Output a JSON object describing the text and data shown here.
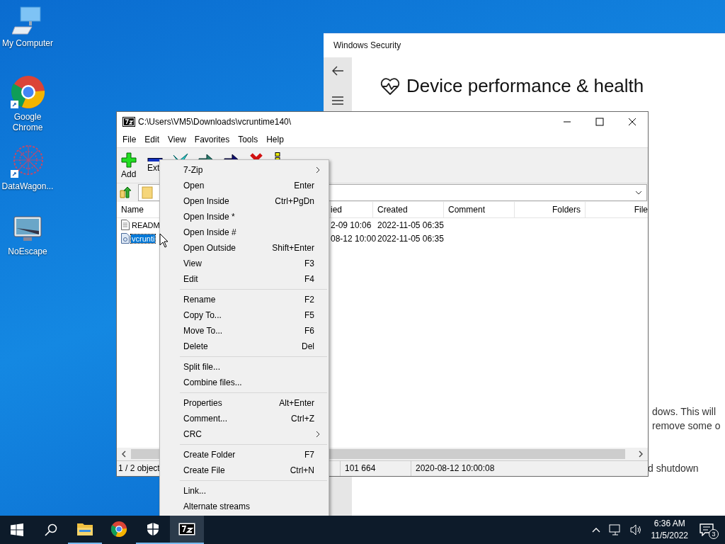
{
  "desktop_icons": [
    {
      "label": "My Computer",
      "kind": "computer"
    },
    {
      "label": "Google Chrome",
      "kind": "chrome"
    },
    {
      "label": "DataWagon...",
      "kind": "datawagon"
    },
    {
      "label": "NoEscape",
      "kind": "noescape"
    }
  ],
  "security_window": {
    "title": "Windows Security",
    "heading": "Device performance & health",
    "lines": [
      "dows. This will",
      "remove some o",
      "d shutdown"
    ]
  },
  "zip_window": {
    "title": "C:\\Users\\VM5\\Downloads\\vcruntime140\\",
    "menu": [
      "File",
      "Edit",
      "View",
      "Favorites",
      "Tools",
      "Help"
    ],
    "toolbar": [
      {
        "kind": "add",
        "label": "Add"
      },
      {
        "kind": "extract",
        "label": "Ext"
      },
      {
        "kind": "test"
      },
      {
        "kind": "copy"
      },
      {
        "kind": "move"
      },
      {
        "kind": "delete"
      },
      {
        "kind": "info"
      }
    ],
    "columns": [
      "Name",
      "ied",
      "Created",
      "Comment",
      "Folders",
      "File"
    ],
    "rows": [
      {
        "kind": "text",
        "name": "READM",
        "column_2": "2-09 10:06",
        "created": "2022-11-05 06:35",
        "selected": false
      },
      {
        "kind": "dll",
        "name": "vcrunti",
        "column_2": "08-12 10:00",
        "created": "2022-11-05 06:35",
        "selected": true
      }
    ],
    "status": [
      "1 / 2 object",
      "101 664",
      "2020-08-12 10:00:08"
    ]
  },
  "context_menu": [
    [
      {
        "label": "7-Zip",
        "submenu": true
      },
      {
        "label": "Open",
        "shortcut": "Enter"
      },
      {
        "label": "Open Inside",
        "shortcut": "Ctrl+PgDn"
      },
      {
        "label": "Open Inside *"
      },
      {
        "label": "Open Inside #"
      },
      {
        "label": "Open Outside",
        "shortcut": "Shift+Enter"
      },
      {
        "label": "View",
        "shortcut": "F3"
      },
      {
        "label": "Edit",
        "shortcut": "F4"
      }
    ],
    [
      {
        "label": "Rename",
        "shortcut": "F2"
      },
      {
        "label": "Copy To...",
        "shortcut": "F5"
      },
      {
        "label": "Move To...",
        "shortcut": "F6"
      },
      {
        "label": "Delete",
        "shortcut": "Del"
      }
    ],
    [
      {
        "label": "Split file..."
      },
      {
        "label": "Combine files..."
      }
    ],
    [
      {
        "label": "Properties",
        "shortcut": "Alt+Enter"
      },
      {
        "label": "Comment...",
        "shortcut": "Ctrl+Z"
      },
      {
        "label": "CRC",
        "submenu": true
      }
    ],
    [
      {
        "label": "Create Folder",
        "shortcut": "F7"
      },
      {
        "label": "Create File",
        "shortcut": "Ctrl+N"
      }
    ],
    [
      {
        "label": "Link..."
      },
      {
        "label": "Alternate streams"
      }
    ]
  ],
  "taskbar": {
    "apps": [
      {
        "kind": "explorer",
        "running": true,
        "active": false
      },
      {
        "kind": "chrome",
        "running": false,
        "active": false
      },
      {
        "kind": "security",
        "running": true,
        "active": false
      },
      {
        "kind": "sevenzip",
        "running": true,
        "active": true
      }
    ],
    "time": "6:36 AM",
    "date": "11/5/2022",
    "notifications": "3"
  }
}
